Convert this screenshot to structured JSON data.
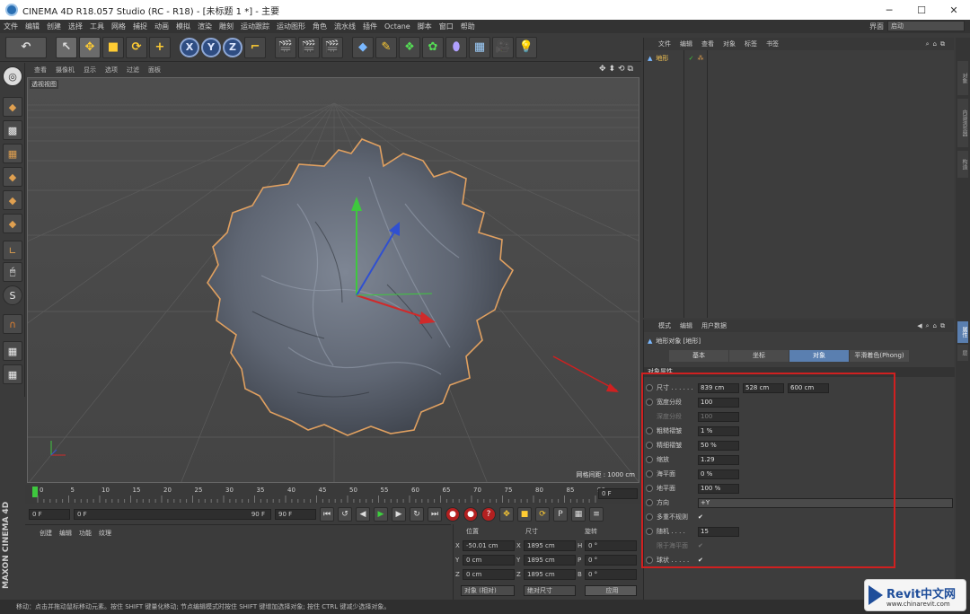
{
  "window": {
    "title": "CINEMA 4D R18.057 Studio (RC - R18) - [未标题 1 *] - 主要",
    "minimize": "─",
    "maximize": "☐",
    "close": "✕"
  },
  "menu": {
    "items": [
      "文件",
      "编辑",
      "创建",
      "选择",
      "工具",
      "网格",
      "捕捉",
      "动画",
      "模拟",
      "渲染",
      "雕刻",
      "运动跟踪",
      "运动图形",
      "角色",
      "流水线",
      "插件",
      "Octane",
      "脚本",
      "窗口",
      "帮助"
    ],
    "layout_label": "界面",
    "layout_value": "启动"
  },
  "toolbar": {
    "undo": "↶",
    "x": "X",
    "y": "Y",
    "z": "Z"
  },
  "viewport": {
    "menu": [
      "查看",
      "摄像机",
      "显示",
      "选项",
      "过滤",
      "面板"
    ],
    "nav_icons": "✥⬍⟲⧉",
    "label": "透视视图",
    "grid_spacing": "网格间距 : 1000 cm"
  },
  "timeline": {
    "ticks": [
      "0",
      "5",
      "10",
      "15",
      "20",
      "25",
      "30",
      "35",
      "40",
      "45",
      "50",
      "55",
      "60",
      "65",
      "70",
      "75",
      "80",
      "85",
      "90"
    ],
    "end_field": "0 F"
  },
  "anim": {
    "start": "0 F",
    "current": "0 F",
    "end_range": "90 F",
    "end": "90 F"
  },
  "material": {
    "menu": [
      "创建",
      "编辑",
      "功能",
      "纹理"
    ]
  },
  "coords": {
    "headers": [
      "位置",
      "尺寸",
      "旋转"
    ],
    "rows": [
      {
        "axis": "X",
        "pos": "-50.01 cm",
        "size_axis": "X",
        "size": "1895 cm",
        "rot_axis": "H",
        "rot": "0 °"
      },
      {
        "axis": "Y",
        "pos": "0 cm",
        "size_axis": "Y",
        "size": "1895 cm",
        "rot_axis": "P",
        "rot": "0 °"
      },
      {
        "axis": "Z",
        "pos": "0 cm",
        "size_axis": "Z",
        "size": "1895 cm",
        "rot_axis": "B",
        "rot": "0 °"
      }
    ],
    "mode1": "对象 (相对)",
    "mode2": "绝对尺寸",
    "apply": "应用"
  },
  "objects": {
    "menu": [
      "文件",
      "编辑",
      "查看",
      "对象",
      "标签",
      "书签"
    ],
    "item": "地形"
  },
  "attributes": {
    "menu": [
      "模式",
      "编辑",
      "用户数据"
    ],
    "title": "地形对象 [地形]",
    "tabs": [
      "基本",
      "坐标",
      "对象",
      "平滑着色(Phong)"
    ],
    "section": "对象属性",
    "size_label": "尺寸 . . . . . .",
    "size": [
      "839 cm",
      "528 cm",
      "600 cm"
    ],
    "params": [
      {
        "label": "宽度分段",
        "value": "100",
        "disabled": false
      },
      {
        "label": "深度分段",
        "value": "100",
        "disabled": true
      },
      {
        "label": "粗糙褶皱",
        "value": "1 %",
        "disabled": false
      },
      {
        "label": "精细褶皱",
        "value": "50 %",
        "disabled": false
      },
      {
        "label": "缩放",
        "value": "1.29",
        "disabled": false
      },
      {
        "label": "海平面",
        "value": "0 %",
        "disabled": false
      },
      {
        "label": "地平面",
        "value": "100 %",
        "disabled": false
      }
    ],
    "direction_label": "方向",
    "direction_value": "+Y",
    "irregular_label": "多重不规则",
    "check": "✔",
    "random_label": "随机 . . . .",
    "random_value": "15",
    "limit_label": "限于海平面",
    "sphere_label": "球状 . . . . ."
  },
  "side_tabs": [
    "对象",
    "内容浏览器",
    "构造",
    "属性",
    "层"
  ],
  "status": "移动：点击并拖动鼠标移动元素。按住 SHIFT 键量化移动; 节点编辑模式时按住 SHIFT 键增加选择对象; 按住 CTRL 键减少选择对象。",
  "maxon": "MAXON CINEMA 4D",
  "watermark": {
    "title": "Revit中文网",
    "url": "www.chinarevit.com"
  }
}
